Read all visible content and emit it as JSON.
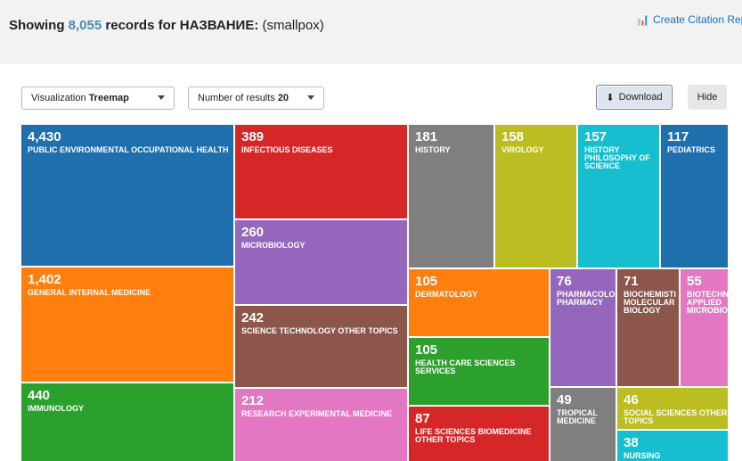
{
  "header": {
    "showing_prefix": "Showing",
    "record_count": "8,055",
    "records_for": "records for НАЗВАНИЕ:",
    "query": "(smallpox)",
    "create_citation_label": "Create Citation Repo"
  },
  "toolbar": {
    "visualization_label": "Visualization",
    "visualization_value": "Treemap",
    "num_results_label": "Number of results",
    "num_results_value": "20",
    "download_label": "Download",
    "hide_label": "Hide"
  },
  "treemap": {
    "tiles": [
      {
        "value": "4,430",
        "label": "PUBLIC ENVIRONMENTAL OCCUPATIONAL HEALTH",
        "color": "#1f6fad"
      },
      {
        "value": "1,402",
        "label": "GENERAL INTERNAL MEDICINE",
        "color": "#ff7f0e"
      },
      {
        "value": "440",
        "label": "IMMUNOLOGY",
        "color": "#2ca02c"
      },
      {
        "value": "389",
        "label": "INFECTIOUS DISEASES",
        "color": "#d62728"
      },
      {
        "value": "260",
        "label": "MICROBIOLOGY",
        "color": "#9467bd"
      },
      {
        "value": "242",
        "label": "SCIENCE TECHNOLOGY OTHER TOPICS",
        "color": "#8c564b"
      },
      {
        "value": "212",
        "label": "RESEARCH EXPERIMENTAL MEDICINE",
        "color": "#e377c2"
      },
      {
        "value": "181",
        "label": "HISTORY",
        "color": "#7f7f7f"
      },
      {
        "value": "158",
        "label": "VIROLOGY",
        "color": "#bcbd22"
      },
      {
        "value": "157",
        "label": "HISTORY PHILOSOPHY OF SCIENCE",
        "color": "#17becf"
      },
      {
        "value": "117",
        "label": "PEDIATRICS",
        "color": "#1f6fad"
      },
      {
        "value": "105",
        "label": "DERMATOLOGY",
        "color": "#ff7f0e"
      },
      {
        "value": "105",
        "label": "HEALTH CARE SCIENCES SERVICES",
        "color": "#2ca02c"
      },
      {
        "value": "87",
        "label": "LIFE SCIENCES BIOMEDICINE OTHER TOPICS",
        "color": "#d62728"
      },
      {
        "value": "76",
        "label": "PHARMACOLO PHARMACY",
        "color": "#9467bd"
      },
      {
        "value": "71",
        "label": "BIOCHEMISTI MOLECULAR BIOLOGY",
        "color": "#8c564b"
      },
      {
        "value": "55",
        "label": "BIOTECHN APPLIED MICROBIO",
        "color": "#e377c2"
      },
      {
        "value": "49",
        "label": "TROPICAL MEDICINE",
        "color": "#7f7f7f"
      },
      {
        "value": "46",
        "label": "SOCIAL SCIENCES OTHER TOPICS",
        "color": "#bcbd22"
      },
      {
        "value": "38",
        "label": "NURSING",
        "color": "#17becf"
      }
    ]
  }
}
